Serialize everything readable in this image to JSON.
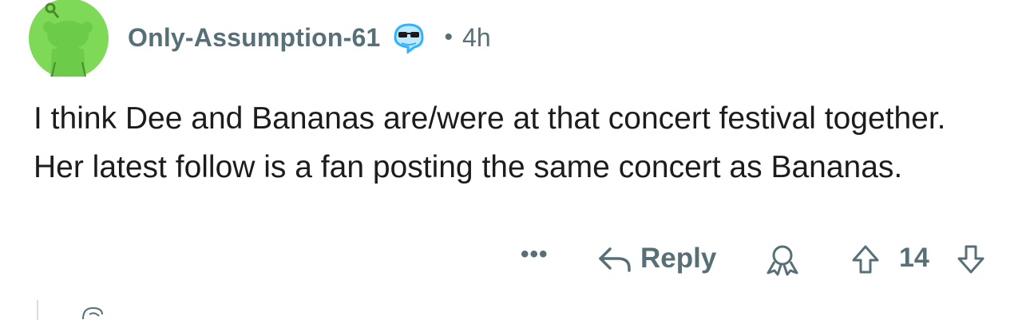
{
  "comment": {
    "username": "Only-Assumption-61",
    "separator": "•",
    "time": "4h",
    "body": "I think Dee and Bananas are/were at that concert festival together. Her latest follow is a fan posting the same concert as Bananas.",
    "avatar_icon": "snoo-avatar-icon",
    "flair_icon": "sunglasses-flair-icon"
  },
  "actions": {
    "more_label": "•••",
    "reply_label": "Reply",
    "award_icon": "award-icon",
    "upvote_icon": "upvote-arrow-icon",
    "score": "14",
    "downvote_icon": "downvote-arrow-icon"
  },
  "colors": {
    "avatar_green": "#7ed957",
    "avatar_dark": "#5fb83c",
    "meta_gray": "#576f76",
    "text": "#1c1c1c",
    "flair_blue": "#2fb3ff"
  }
}
